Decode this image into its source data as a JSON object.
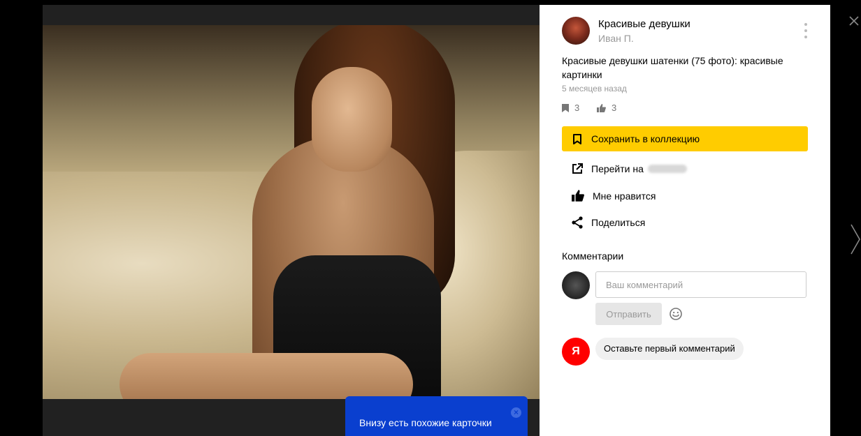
{
  "board": {
    "title": "Красивые девушки",
    "author": "Иван П."
  },
  "card": {
    "description": "Красивые девушки шатенки (75 фото): красивые картинки",
    "time": "5 месяцев назад",
    "saves_count": "3",
    "likes_count": "3"
  },
  "actions": {
    "save_label": "Сохранить в коллекцию",
    "goto_label": "Перейти на",
    "like_label": "Мне нравится",
    "share_label": "Поделиться"
  },
  "comments": {
    "title": "Комментарии",
    "placeholder": "Ваш комментарий",
    "send_label": "Отправить",
    "ya_letter": "Я",
    "first_comment": "Оставьте первый комментарий"
  },
  "toast": {
    "text": "Внизу есть похожие карточки",
    "close_glyph": "×"
  },
  "colors": {
    "accent_yellow": "#ffcc00",
    "toast_blue": "#0a3fcf",
    "ya_red": "#ff0000"
  }
}
